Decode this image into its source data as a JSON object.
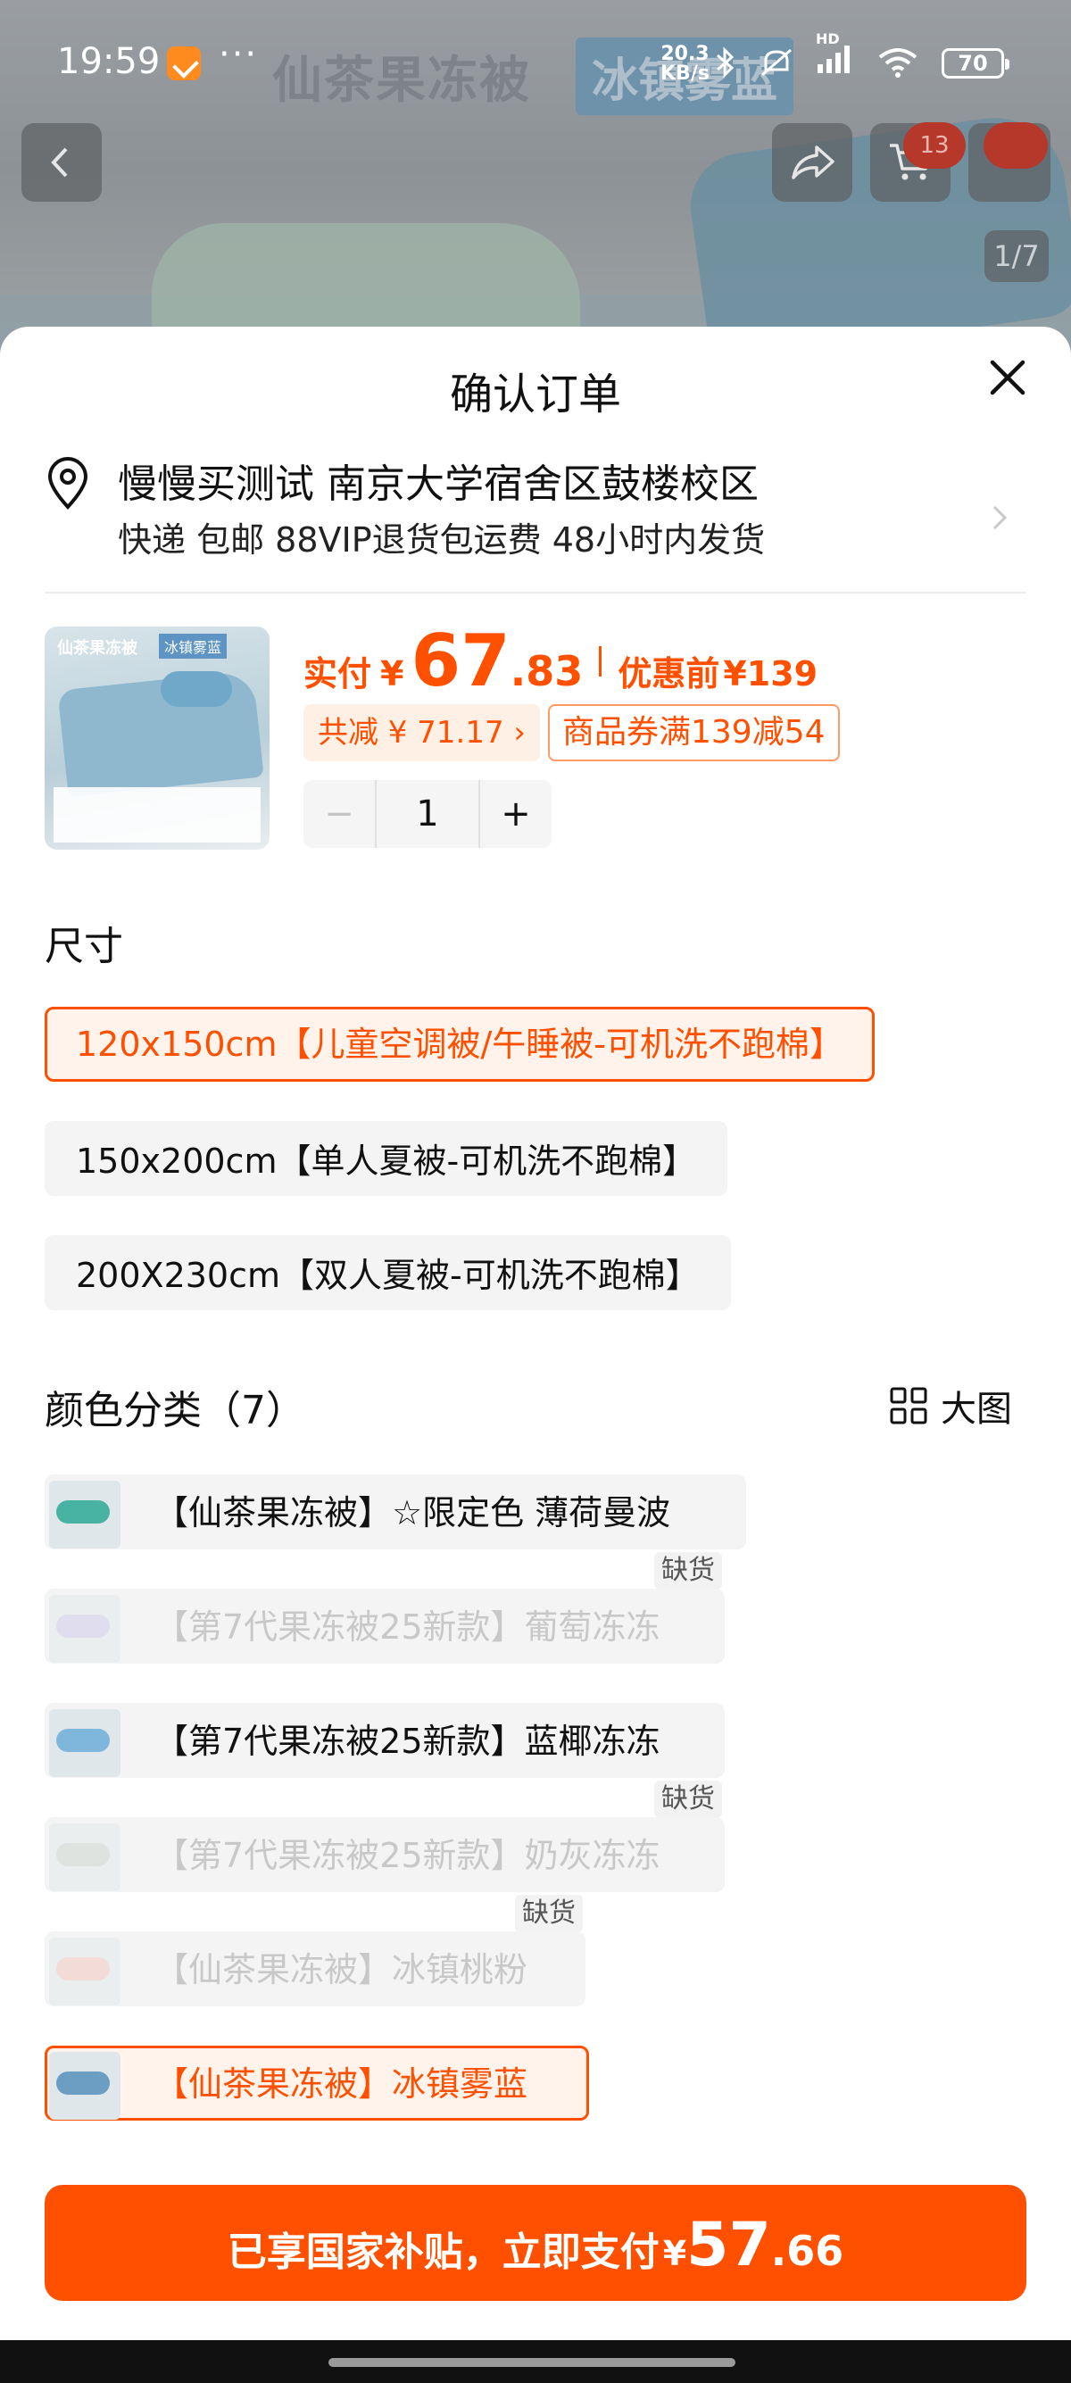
{
  "status_bar": {
    "time": "19:59",
    "more": "···",
    "net_speed_value": "20.3",
    "net_speed_unit": "KB/s",
    "signal_tag": "HD",
    "battery": "70"
  },
  "backdrop": {
    "banner_title": "仙茶果冻被",
    "banner_tag": "冰镇雾蓝",
    "cart_badge": "13",
    "image_counter": "1/7"
  },
  "sheet": {
    "title": "确认订单",
    "address": {
      "line1": "慢慢买测试 南京大学宿舍区鼓楼校区",
      "line2": "快递 包邮 88VIP退货包运费 48小时内发货"
    },
    "product": {
      "image_title": "仙茶果冻被",
      "image_tag": "冰镇雾蓝",
      "price_label": "实付",
      "currency": "¥",
      "price_int": "67",
      "price_dec": ".83",
      "orig_label": "优惠前",
      "orig_price": "¥139",
      "discount_total": "共减 ¥ 71.17 ›",
      "coupon": "商品券满139减54",
      "quantity": "1",
      "minus": "−",
      "plus": "+"
    },
    "size": {
      "label": "尺寸",
      "options": [
        {
          "label": "120x150cm【儿童空调被/午睡被-可机洗不跑棉】",
          "selected": true
        },
        {
          "label": "150x200cm【单人夏被-可机洗不跑棉】",
          "selected": false
        },
        {
          "label": "200X230cm【双人夏被-可机洗不跑棉】",
          "selected": false
        }
      ]
    },
    "color": {
      "label": "颜色分类（7）",
      "big_view": "大图",
      "out_of_stock": "缺货",
      "options": [
        {
          "label": "【仙茶果冻被】☆限定色 薄荷曼波",
          "state": "available",
          "swatch": "#49b3a3"
        },
        {
          "label": "【第7代果冻被25新款】葡萄冻冻",
          "state": "out_of_stock",
          "swatch": "#c9c3e8"
        },
        {
          "label": "【第7代果冻被25新款】蓝椰冻冻",
          "state": "available",
          "swatch": "#7fb6dc"
        },
        {
          "label": "【第7代果冻被25新款】奶灰冻冻",
          "state": "out_of_stock",
          "swatch": "#c4cfc9"
        },
        {
          "label": "【仙茶果冻被】冰镇桃粉",
          "state": "out_of_stock",
          "swatch": "#f2c1b8"
        },
        {
          "label": "【仙茶果冻被】冰镇雾蓝",
          "state": "selected",
          "swatch": "#6c9ec3"
        }
      ]
    },
    "pay_button": {
      "text": "已享国家补贴，立即支付",
      "currency": "¥",
      "amount_int": "57",
      "amount_dec": ".66"
    }
  },
  "colors": {
    "accent": "#ff5000",
    "accent_light_bg": "#fff3ec",
    "option_bg": "#f4f4f4"
  }
}
